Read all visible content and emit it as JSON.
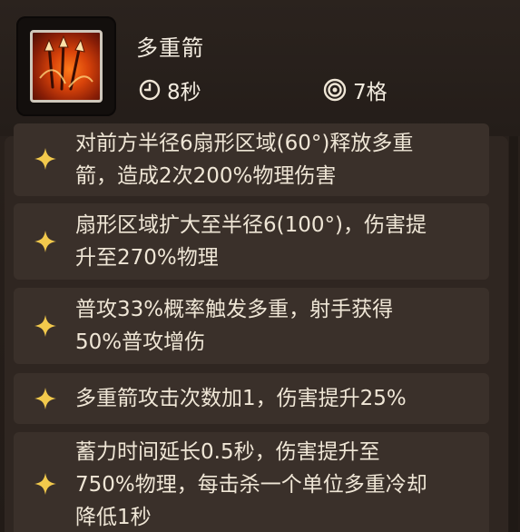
{
  "skill": {
    "name": "多重箭",
    "cooldown": "8秒",
    "range": "7格",
    "icon": "multi-arrow-skill-icon"
  },
  "upgrades": [
    {
      "text": "对前方半径6扇形区域(60°)释放多重\n箭，造成2次200%物理伤害"
    },
    {
      "text": "扇形区域扩大至半径6(100°)，伤害提\n升至270%物理"
    },
    {
      "text": "普攻33%概率触发多重，射手获得\n50%普攻增伤"
    },
    {
      "text": "多重箭攻击次数加1，伤害提升25%"
    },
    {
      "text": "蓄力时间延长0.5秒，伤害提升至\n750%物理，每击杀一个单位多重冷却\n降低1秒"
    }
  ],
  "colors": {
    "star": "#f2c94c",
    "panel": "#2a221d",
    "row": "#3a302a",
    "text": "#efe6d6"
  }
}
